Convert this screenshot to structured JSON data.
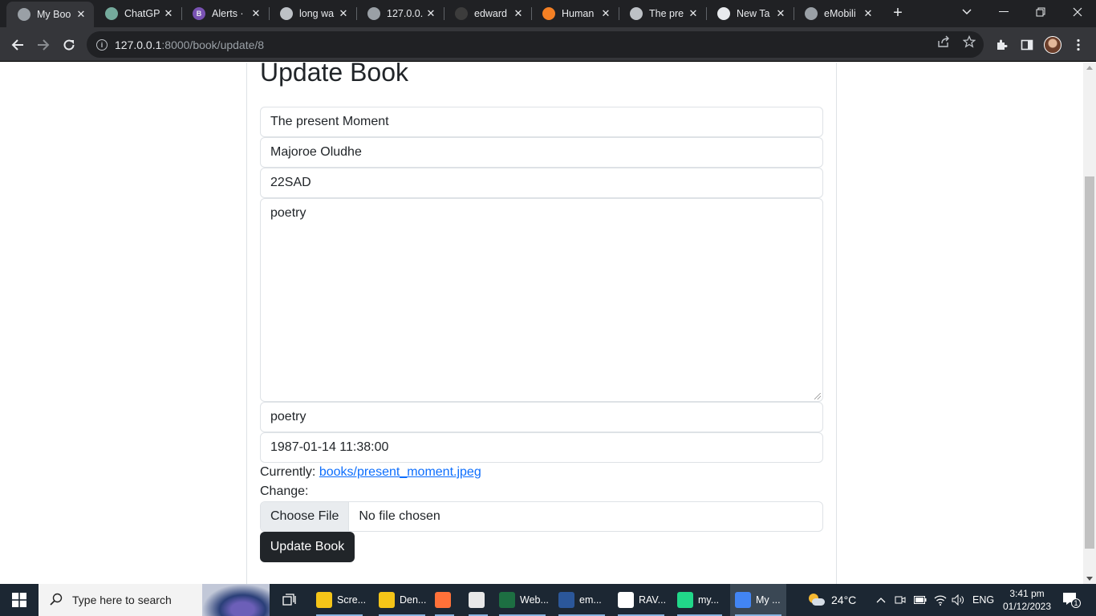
{
  "browser": {
    "tabs": [
      {
        "title": "My Boo",
        "favicon_color": "#9aa0a6",
        "favicon_text": "",
        "active": true
      },
      {
        "title": "ChatGP",
        "favicon_color": "#74aa9c",
        "favicon_text": "",
        "active": false
      },
      {
        "title": "Alerts ·",
        "favicon_color": "#7952b3",
        "favicon_text": "B",
        "active": false
      },
      {
        "title": "long wa",
        "favicon_color": "#bdc1c6",
        "favicon_text": "",
        "active": false
      },
      {
        "title": "127.0.0.",
        "favicon_color": "#9aa0a6",
        "favicon_text": "",
        "active": false
      },
      {
        "title": "edward",
        "favicon_color": "#3c3c3c",
        "favicon_text": "",
        "active": false
      },
      {
        "title": "Human",
        "favicon_color": "#f48024",
        "favicon_text": "",
        "active": false
      },
      {
        "title": "The pre",
        "favicon_color": "#bdc1c6",
        "favicon_text": "",
        "active": false
      },
      {
        "title": "New Ta",
        "favicon_color": "#e8eaed",
        "favicon_text": "",
        "active": false
      },
      {
        "title": "eMobili",
        "favicon_color": "#9aa0a6",
        "favicon_text": "",
        "active": false
      }
    ],
    "url_host": "127.0.0.1",
    "url_rest": ":8000/book/update/8"
  },
  "page": {
    "title": "Update Book",
    "fields": {
      "title": "The present Moment",
      "author": "Majoroe Oludhe",
      "isbn": "22SAD",
      "description": "poetry",
      "genre": "poetry",
      "published": "1987-01-14 11:38:00"
    },
    "currently_label": "Currently:",
    "current_file": "books/present_moment.jpeg",
    "change_label": "Change:",
    "choose_file_label": "Choose File",
    "no_file_label": "No file chosen",
    "submit_label": "Update Book"
  },
  "taskbar": {
    "search_placeholder": "Type here to search",
    "items": [
      {
        "label": "Scre...",
        "icon": "folder-icon",
        "color": "#f5c518"
      },
      {
        "label": "Den...",
        "icon": "folder-icon",
        "color": "#f5c518"
      },
      {
        "label": "",
        "icon": "firefox-icon",
        "color": "#ff7139"
      },
      {
        "label": "",
        "icon": "calendar-app-icon",
        "color": "#e8e8e8"
      },
      {
        "label": "Web...",
        "icon": "excel-icon",
        "color": "#1d6f42"
      },
      {
        "label": "em...",
        "icon": "word-icon",
        "color": "#2b579a"
      },
      {
        "label": "RAV...",
        "icon": "rav-icon",
        "color": "#ffffff"
      },
      {
        "label": "my...",
        "icon": "pycharm-icon",
        "color": "#21d789"
      },
      {
        "label": "My ...",
        "icon": "chrome-icon",
        "color": "#4285f4"
      }
    ],
    "weather": "24°C",
    "language": "ENG",
    "time": "3:41 pm",
    "date": "01/12/2023",
    "notification_count": "1"
  },
  "colors": {
    "accent": "#0d6efd",
    "button_dark": "#212529",
    "chrome_dark": "#202124"
  }
}
